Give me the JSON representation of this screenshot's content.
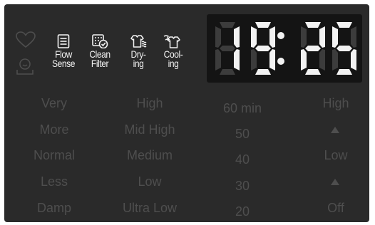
{
  "colors": {
    "panel": "#2a2a2a",
    "lit": "#f2f2f2",
    "dim": "#4e4e4e",
    "dim_segment": "#3c3c3c"
  },
  "status_icons": [
    "heart-icon",
    "child-lock-icon"
  ],
  "modes": [
    {
      "line1": "Flow",
      "line2": "Sense",
      "icon": "flow-sense-icon"
    },
    {
      "line1": "Clean",
      "line2": "Filter",
      "icon": "clean-filter-icon"
    },
    {
      "line1": "Dry-",
      "line2": "ing",
      "icon": "drying-icon"
    },
    {
      "line1": "Cool-",
      "line2": "ing",
      "icon": "cooling-icon"
    }
  ],
  "display": {
    "digits": [
      "8",
      "8",
      "8",
      "8"
    ],
    "lit": [
      "1",
      "9",
      "2",
      "5"
    ],
    "colon": ":"
  },
  "dryness": [
    "Very",
    "More",
    "Normal",
    "Less",
    "Damp"
  ],
  "temperature": [
    "High",
    "Mid High",
    "Medium",
    "Low",
    "Ultra Low"
  ],
  "time": [
    "60 min",
    "50",
    "40",
    "30",
    "20"
  ],
  "level": [
    "High",
    "▲",
    "Low",
    "▲",
    "Off"
  ]
}
